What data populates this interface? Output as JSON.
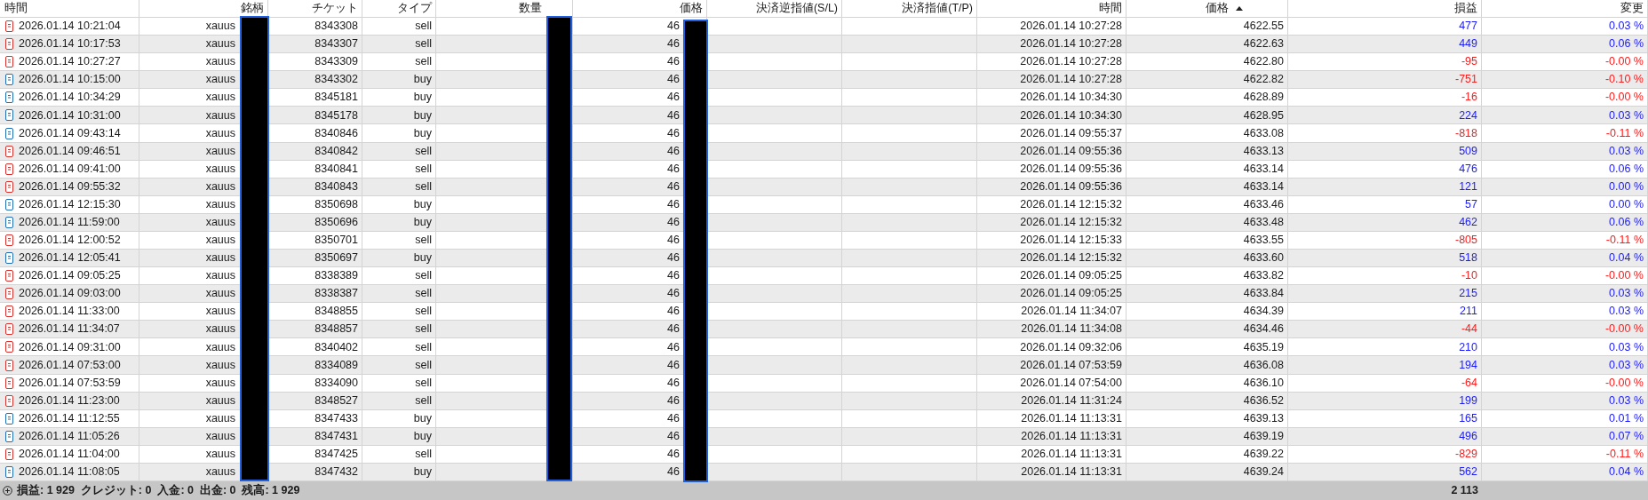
{
  "columns": [
    {
      "label": "時間",
      "sorted": false
    },
    {
      "label": "銘柄",
      "sorted": false
    },
    {
      "label": "チケット",
      "sorted": false
    },
    {
      "label": "タイプ",
      "sorted": false
    },
    {
      "label": "数量",
      "sorted": false
    },
    {
      "label": "価格",
      "sorted": false
    },
    {
      "label": "決済逆指値(S/L)",
      "sorted": false
    },
    {
      "label": "決済指値(T/P)",
      "sorted": false
    },
    {
      "label": "時間",
      "sorted": false
    },
    {
      "label": "価格",
      "sorted": true
    },
    {
      "label": "損益",
      "sorted": false
    },
    {
      "label": "変更",
      "sorted": false
    }
  ],
  "rows": [
    {
      "kind": "sell",
      "time": "2026.01.14 10:21:04",
      "symbol": "xauus",
      "ticket": "8343308",
      "type": "sell",
      "price": "46",
      "close_time": "2026.01.14 10:27:28",
      "close_price": "4622.55",
      "profit": "477",
      "change": "0.03 %",
      "loss": false
    },
    {
      "kind": "sell",
      "time": "2026.01.14 10:17:53",
      "symbol": "xauus",
      "ticket": "8343307",
      "type": "sell",
      "price": "46",
      "close_time": "2026.01.14 10:27:28",
      "close_price": "4622.63",
      "profit": "449",
      "change": "0.06 %",
      "loss": false
    },
    {
      "kind": "sell",
      "time": "2026.01.14 10:27:27",
      "symbol": "xauus",
      "ticket": "8343309",
      "type": "sell",
      "price": "46",
      "close_time": "2026.01.14 10:27:28",
      "close_price": "4622.80",
      "profit": "-95",
      "change": "-0.00 %",
      "loss": true
    },
    {
      "kind": "buy",
      "time": "2026.01.14 10:15:00",
      "symbol": "xauus",
      "ticket": "8343302",
      "type": "buy",
      "price": "46",
      "close_time": "2026.01.14 10:27:28",
      "close_price": "4622.82",
      "profit": "-751",
      "change": "-0.10 %",
      "loss": true
    },
    {
      "kind": "buy",
      "time": "2026.01.14 10:34:29",
      "symbol": "xauus",
      "ticket": "8345181",
      "type": "buy",
      "price": "46",
      "close_time": "2026.01.14 10:34:30",
      "close_price": "4628.89",
      "profit": "-16",
      "change": "-0.00 %",
      "loss": true
    },
    {
      "kind": "buy",
      "time": "2026.01.14 10:31:00",
      "symbol": "xauus",
      "ticket": "8345178",
      "type": "buy",
      "price": "46",
      "close_time": "2026.01.14 10:34:30",
      "close_price": "4628.95",
      "profit": "224",
      "change": "0.03 %",
      "loss": false
    },
    {
      "kind": "buy",
      "time": "2026.01.14 09:43:14",
      "symbol": "xauus",
      "ticket": "8340846",
      "type": "buy",
      "price": "46",
      "close_time": "2026.01.14 09:55:37",
      "close_price": "4633.08",
      "profit": "-818",
      "change": "-0.11 %",
      "loss": true
    },
    {
      "kind": "sell",
      "time": "2026.01.14 09:46:51",
      "symbol": "xauus",
      "ticket": "8340842",
      "type": "sell",
      "price": "46",
      "close_time": "2026.01.14 09:55:36",
      "close_price": "4633.13",
      "profit": "509",
      "change": "0.03 %",
      "loss": false
    },
    {
      "kind": "sell",
      "time": "2026.01.14 09:41:00",
      "symbol": "xauus",
      "ticket": "8340841",
      "type": "sell",
      "price": "46",
      "close_time": "2026.01.14 09:55:36",
      "close_price": "4633.14",
      "profit": "476",
      "change": "0.06 %",
      "loss": false
    },
    {
      "kind": "sell",
      "time": "2026.01.14 09:55:32",
      "symbol": "xauus",
      "ticket": "8340843",
      "type": "sell",
      "price": "46",
      "close_time": "2026.01.14 09:55:36",
      "close_price": "4633.14",
      "profit": "121",
      "change": "0.00 %",
      "loss": false
    },
    {
      "kind": "buy",
      "time": "2026.01.14 12:15:30",
      "symbol": "xauus",
      "ticket": "8350698",
      "type": "buy",
      "price": "46",
      "close_time": "2026.01.14 12:15:32",
      "close_price": "4633.46",
      "profit": "57",
      "change": "0.00 %",
      "loss": false
    },
    {
      "kind": "buy",
      "time": "2026.01.14 11:59:00",
      "symbol": "xauus",
      "ticket": "8350696",
      "type": "buy",
      "price": "46",
      "close_time": "2026.01.14 12:15:32",
      "close_price": "4633.48",
      "profit": "462",
      "change": "0.06 %",
      "loss": false
    },
    {
      "kind": "sell",
      "time": "2026.01.14 12:00:52",
      "symbol": "xauus",
      "ticket": "8350701",
      "type": "sell",
      "price": "46",
      "close_time": "2026.01.14 12:15:33",
      "close_price": "4633.55",
      "profit": "-805",
      "change": "-0.11 %",
      "loss": true
    },
    {
      "kind": "buy",
      "time": "2026.01.14 12:05:41",
      "symbol": "xauus",
      "ticket": "8350697",
      "type": "buy",
      "price": "46",
      "close_time": "2026.01.14 12:15:32",
      "close_price": "4633.60",
      "profit": "518",
      "change": "0.04 %",
      "loss": false
    },
    {
      "kind": "sell",
      "time": "2026.01.14 09:05:25",
      "symbol": "xauus",
      "ticket": "8338389",
      "type": "sell",
      "price": "46",
      "close_time": "2026.01.14 09:05:25",
      "close_price": "4633.82",
      "profit": "-10",
      "change": "-0.00 %",
      "loss": true
    },
    {
      "kind": "sell",
      "time": "2026.01.14 09:03:00",
      "symbol": "xauus",
      "ticket": "8338387",
      "type": "sell",
      "price": "46",
      "close_time": "2026.01.14 09:05:25",
      "close_price": "4633.84",
      "profit": "215",
      "change": "0.03 %",
      "loss": false
    },
    {
      "kind": "sell",
      "time": "2026.01.14 11:33:00",
      "symbol": "xauus",
      "ticket": "8348855",
      "type": "sell",
      "price": "46",
      "close_time": "2026.01.14 11:34:07",
      "close_price": "4634.39",
      "profit": "211",
      "change": "0.03 %",
      "loss": false
    },
    {
      "kind": "sell",
      "time": "2026.01.14 11:34:07",
      "symbol": "xauus",
      "ticket": "8348857",
      "type": "sell",
      "price": "46",
      "close_time": "2026.01.14 11:34:08",
      "close_price": "4634.46",
      "profit": "-44",
      "change": "-0.00 %",
      "loss": true
    },
    {
      "kind": "sell",
      "time": "2026.01.14 09:31:00",
      "symbol": "xauus",
      "ticket": "8340402",
      "type": "sell",
      "price": "46",
      "close_time": "2026.01.14 09:32:06",
      "close_price": "4635.19",
      "profit": "210",
      "change": "0.03 %",
      "loss": false
    },
    {
      "kind": "sell",
      "time": "2026.01.14 07:53:00",
      "symbol": "xauus",
      "ticket": "8334089",
      "type": "sell",
      "price": "46",
      "close_time": "2026.01.14 07:53:59",
      "close_price": "4636.08",
      "profit": "194",
      "change": "0.03 %",
      "loss": false
    },
    {
      "kind": "sell",
      "time": "2026.01.14 07:53:59",
      "symbol": "xauus",
      "ticket": "8334090",
      "type": "sell",
      "price": "46",
      "close_time": "2026.01.14 07:54:00",
      "close_price": "4636.10",
      "profit": "-64",
      "change": "-0.00 %",
      "loss": true
    },
    {
      "kind": "sell",
      "time": "2026.01.14 11:23:00",
      "symbol": "xauus",
      "ticket": "8348527",
      "type": "sell",
      "price": "46",
      "close_time": "2026.01.14 11:31:24",
      "close_price": "4636.52",
      "profit": "199",
      "change": "0.03 %",
      "loss": false
    },
    {
      "kind": "buy",
      "time": "2026.01.14 11:12:55",
      "symbol": "xauus",
      "ticket": "8347433",
      "type": "buy",
      "price": "46",
      "close_time": "2026.01.14 11:13:31",
      "close_price": "4639.13",
      "profit": "165",
      "change": "0.01 %",
      "loss": false
    },
    {
      "kind": "buy",
      "time": "2026.01.14 11:05:26",
      "symbol": "xauus",
      "ticket": "8347431",
      "type": "buy",
      "price": "46",
      "close_time": "2026.01.14 11:13:31",
      "close_price": "4639.19",
      "profit": "496",
      "change": "0.07 %",
      "loss": false
    },
    {
      "kind": "sell",
      "time": "2026.01.14 11:04:00",
      "symbol": "xauus",
      "ticket": "8347425",
      "type": "sell",
      "price": "46",
      "close_time": "2026.01.14 11:13:31",
      "close_price": "4639.22",
      "profit": "-829",
      "change": "-0.11 %",
      "loss": true
    },
    {
      "kind": "buy",
      "time": "2026.01.14 11:08:05",
      "symbol": "xauus",
      "ticket": "8347432",
      "type": "buy",
      "price": "46",
      "close_time": "2026.01.14 11:13:31",
      "close_price": "4639.24",
      "profit": "562",
      "change": "0.04 %",
      "loss": false
    }
  ],
  "summary": {
    "text": "損益: 1 929  クレジット: 0  入金: 0  出金: 0  残高: 1 929",
    "total_profit": "2 113"
  }
}
